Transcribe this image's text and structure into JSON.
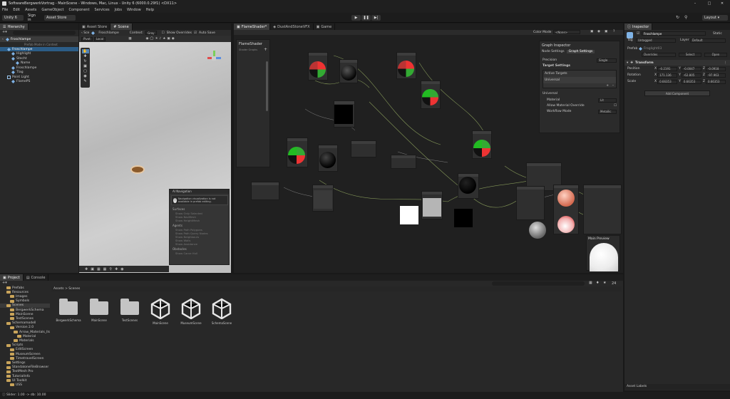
{
  "window": {
    "title": "SoftwareBergwerkVortrag - MainScene - Windows, Mac, Linux - Unity 6 (6000.0.29f1) <DX11>"
  },
  "menu": [
    "File",
    "Edit",
    "Assets",
    "GameObject",
    "Component",
    "Services",
    "Jobs",
    "Window",
    "Help"
  ],
  "toolbar": {
    "account": "Unity 6",
    "sign_in": "Sign in",
    "asset_store": "Asset Store",
    "layout": "Layout"
  },
  "hierarchy": {
    "tab": "Hierarchy",
    "root": "Froschlampe",
    "breadcrumb": "Prefab Mode in Context",
    "items": [
      {
        "label": "Froschlampe",
        "indent": 1,
        "selected": true
      },
      {
        "label": "Highlight",
        "indent": 2,
        "selected": false
      },
      {
        "label": "Stecht",
        "indent": 2,
        "selected": false
      },
      {
        "label": "Name",
        "indent": 3,
        "selected": false
      },
      {
        "label": "Froschlampe",
        "indent": 2,
        "selected": false
      },
      {
        "label": "Tlag",
        "indent": 2,
        "selected": false
      },
      {
        "label": "Point Light",
        "indent": 1,
        "selected": false
      },
      {
        "label": "FlamePS",
        "indent": 2,
        "selected": false
      }
    ]
  },
  "scene": {
    "tabs": [
      "Asset Store",
      "Scene"
    ],
    "breadcrumb": "Froschlampe",
    "context_label": "Context:",
    "context_value": "Gray",
    "show_overrides": "Show Overrides",
    "auto_save": "Auto Save",
    "pivot": "Pivot",
    "local": "Local",
    "ai_nav": {
      "title": "AI Navigation",
      "warning": "Navigation visualization is not available in prefab editing.",
      "surfaces_label": "Surfaces",
      "surfaces": [
        "Show Only Selected",
        "Show NavMesh",
        "Show HeightMesh"
      ],
      "agents_label": "Agents",
      "agents": [
        "Show Path Polygons",
        "Show Path Query Nodes",
        "Show Neighbours",
        "Show Walls",
        "Show Avoidance"
      ],
      "obstacles_label": "Obstacles",
      "obstacles": [
        "Show Carve Hull"
      ]
    }
  },
  "graph": {
    "tabs": [
      "FlameShader*",
      "DustAndStoneVFX",
      "Game"
    ],
    "color_mode_label": "Color Mode",
    "color_mode_value": "<None>",
    "blackboard_title": "FlameShader",
    "blackboard_sub": "Shader Graphs",
    "inspector": {
      "title": "Graph Inspector",
      "tabs": [
        "Node Settings",
        "Graph Settings"
      ],
      "precision_label": "Precision",
      "precision_value": "Single",
      "target_settings": "Target Settings",
      "active_targets": "Active Targets",
      "universal": "Universal",
      "universal_section": "Universal",
      "material_label": "Material",
      "material_value": "Lit",
      "allow_override": "Allow Material Override",
      "workflow_label": "Workflow Mode",
      "workflow_value": "Metallic"
    },
    "main_preview": "Main Preview"
  },
  "inspector": {
    "tab": "Inspector",
    "name": "Froschlampe",
    "static": "Static",
    "tag_label": "Tag",
    "tag_value": "Untagged",
    "layer_label": "Layer",
    "layer_value": "Default",
    "prefab_label": "Prefab",
    "prefab_value": "Froglight03",
    "overrides": "Overrides",
    "select": "Select",
    "open": "Open",
    "transform": "Transform",
    "position_label": "Position",
    "rotation_label": "Rotation",
    "scale_label": "Scale",
    "position": [
      "-0.2191",
      "-0.0047",
      "-0.0918"
    ],
    "rotation": [
      "171.136",
      "-62.805",
      "-97.963"
    ],
    "scale": [
      "0.66353",
      "0.66353",
      "0.66353"
    ],
    "add_component": "Add Component",
    "asset_labels": "Asset Labels"
  },
  "project": {
    "tabs": [
      "Project",
      "Console"
    ],
    "path": "Assets > Scenes",
    "count": "24",
    "tree": [
      {
        "label": "Prefabs",
        "indent": 1
      },
      {
        "label": "Resources",
        "indent": 1
      },
      {
        "label": "Images",
        "indent": 2
      },
      {
        "label": "Symbols",
        "indent": 2
      },
      {
        "label": "Scenes",
        "indent": 1,
        "selected": true
      },
      {
        "label": "BergwerkSchema",
        "indent": 2
      },
      {
        "label": "MainScene",
        "indent": 2
      },
      {
        "label": "TestScenes",
        "indent": 2
      },
      {
        "label": "Schemamodell",
        "indent": 1
      },
      {
        "label": "Version 2.0",
        "indent": 2
      },
      {
        "label": "Arrow_Materials_lls",
        "indent": 3
      },
      {
        "label": "Material",
        "indent": 4
      },
      {
        "label": "Materials",
        "indent": 3
      },
      {
        "label": "Scripts",
        "indent": 1
      },
      {
        "label": "EditScreen",
        "indent": 2
      },
      {
        "label": "MuseumScreen",
        "indent": 2
      },
      {
        "label": "TimetravelScreen",
        "indent": 2
      },
      {
        "label": "Settings",
        "indent": 1
      },
      {
        "label": "StandaloneFileBrowser",
        "indent": 1
      },
      {
        "label": "TextMesh Pro",
        "indent": 1
      },
      {
        "label": "TutorialInfo",
        "indent": 1
      },
      {
        "label": "UI Toolkit",
        "indent": 1
      },
      {
        "label": "USS",
        "indent": 2
      }
    ],
    "assets": [
      {
        "label": "BergwerkSchema",
        "kind": "folder"
      },
      {
        "label": "MainScene",
        "kind": "folder"
      },
      {
        "label": "TestScenes",
        "kind": "folder"
      },
      {
        "label": "MainScene",
        "kind": "unity"
      },
      {
        "label": "MuseumScene",
        "kind": "unity"
      },
      {
        "label": "SchemaScene",
        "kind": "unity"
      }
    ]
  },
  "status": {
    "text": "Slider: 1.00 -> db: 10.00"
  }
}
